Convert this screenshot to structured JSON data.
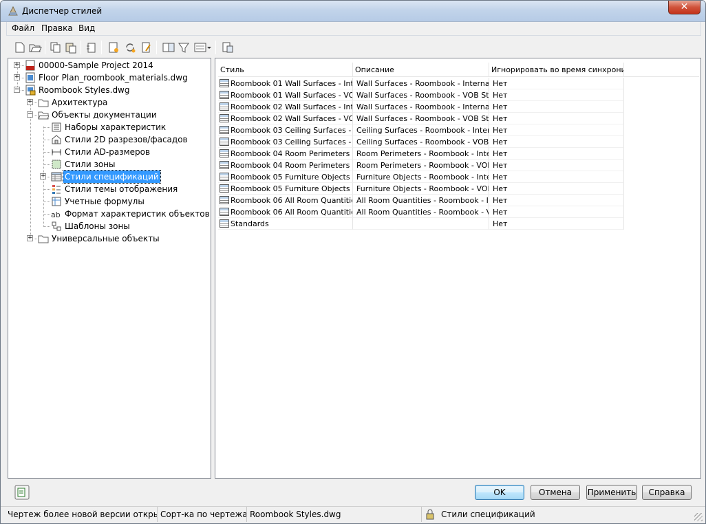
{
  "window": {
    "title": "Диспетчер стилей",
    "close_label": "✕"
  },
  "menu": [
    {
      "label": "Файл"
    },
    {
      "label": "Правка"
    },
    {
      "label": "Вид"
    }
  ],
  "toolbar": {
    "icons": [
      "new-icon",
      "open-icon",
      "copy-icon",
      "paste-icon",
      "purge-icon",
      "new-style-icon",
      "sync-icon",
      "edit-icon",
      "compare-icon",
      "filter-icon",
      "view-mode-icon",
      "properties-icon"
    ]
  },
  "tree": {
    "items": [
      {
        "label": "00000-Sample Project 2014",
        "icon": "pdf-project-icon",
        "level": 0,
        "expander": "+"
      },
      {
        "label": "Floor Plan_roombook_materials.dwg",
        "icon": "dwg-file-icon",
        "level": 0,
        "expander": "+"
      },
      {
        "label": "Roombook Styles.dwg",
        "icon": "dwg-locked-file-icon",
        "level": 0,
        "expander": "-"
      },
      {
        "label": "Архитектура",
        "icon": "folder-icon",
        "level": 1,
        "expander": "+"
      },
      {
        "label": "Объекты документации",
        "icon": "folder-open-icon",
        "level": 1,
        "expander": "-"
      },
      {
        "label": "Наборы характеристик",
        "icon": "property-set-icon",
        "level": 2,
        "expander": ""
      },
      {
        "label": "Стили 2D разрезов/фасадов",
        "icon": "section-elevation-icon",
        "level": 2,
        "expander": ""
      },
      {
        "label": "Стили AD-размеров",
        "icon": "dimension-icon",
        "level": 2,
        "expander": ""
      },
      {
        "label": "Стили зоны",
        "icon": "zone-icon",
        "level": 2,
        "expander": ""
      },
      {
        "label": "Стили спецификаций",
        "icon": "schedule-table-icon",
        "level": 2,
        "expander": "+",
        "selected": true
      },
      {
        "label": "Стили темы отображения",
        "icon": "display-theme-icon",
        "level": 2,
        "expander": ""
      },
      {
        "label": "Учетные формулы",
        "icon": "formula-icon",
        "level": 2,
        "expander": ""
      },
      {
        "label": "Формат характеристик объектов",
        "icon": "property-format-icon",
        "level": 2,
        "expander": ""
      },
      {
        "label": "Шаблоны зоны",
        "icon": "zone-template-icon",
        "level": 2,
        "expander": ""
      },
      {
        "label": "Универсальные объекты",
        "icon": "folder-icon",
        "level": 1,
        "expander": "+"
      }
    ]
  },
  "table": {
    "columns": [
      "Стиль",
      "Описание",
      "Игнорировать во время синхрони..."
    ],
    "rows": [
      [
        "Roombook 01 Wall Surfaces - Int...",
        "Wall Surfaces - Roombook - Interna",
        "Нет"
      ],
      [
        "Roombook 01 Wall Surfaces - VO...",
        "Wall Surfaces - Roombook - VOB Stand",
        "Нет"
      ],
      [
        "Roombook 02 Wall Surfaces - Int...",
        "Wall Surfaces - Roombook - Interna",
        "Нет"
      ],
      [
        "Roombook 02 Wall Surfaces - VO...",
        "Wall Surfaces - Roombook - VOB Stand",
        "Нет"
      ],
      [
        "Roombook 03 Ceiling Surfaces - ...",
        "Ceiling Surfaces - Roombook - Interna",
        "Нет"
      ],
      [
        "Roombook 03 Ceiling Surfaces - ...",
        "Ceiling Surfaces - Roombook - VOB ...",
        "Нет"
      ],
      [
        "Roombook 04 Room Perimeters - ...",
        "Room Perimeters - Roombook - Inte...",
        "Нет"
      ],
      [
        "Roombook 04 Room Perimeters - ...",
        "Room Perimeters - Roombook - VOB ...",
        "Нет"
      ],
      [
        "Roombook 05 Furniture Objects -...",
        "Furniture Objects - Roombook - Inte...",
        "Нет"
      ],
      [
        "Roombook 05 Furniture Objects -...",
        "Furniture Objects - Roombook - VOB...",
        "Нет"
      ],
      [
        "Roombook 06 All Room Quantitie...",
        "All Room Quantities - Roombook - In...",
        "Нет"
      ],
      [
        "Roombook 06 All Room Quantitie...",
        "All Room Quantities - Roombook - V...",
        "Нет"
      ],
      [
        "Standards",
        "",
        "Нет"
      ]
    ]
  },
  "buttons": {
    "ok": "OK",
    "cancel": "Отмена",
    "apply": "Применить",
    "help": "Справка"
  },
  "status": {
    "message": "Чертеж более новой версии открыт то",
    "sort": "Сорт-ка по чертежам",
    "file": "Roombook Styles.dwg",
    "category": "Стили спецификаций"
  }
}
